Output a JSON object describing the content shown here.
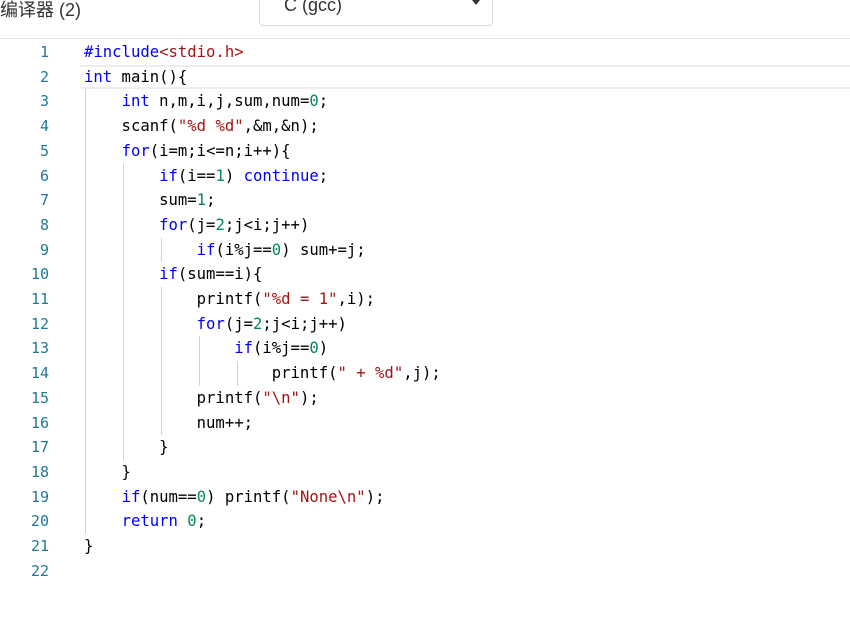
{
  "compiler_label": "编译器 (2)",
  "language_select": {
    "selected": "C (gcc)"
  },
  "editor": {
    "lines": [
      {
        "number": "1",
        "tokens": [
          {
            "t": "pp",
            "v": "#include"
          },
          {
            "t": "ppstr",
            "v": "<stdio.h>"
          }
        ]
      },
      {
        "number": "2",
        "tokens": [
          {
            "t": "kw",
            "v": "int"
          },
          {
            "t": "plain",
            "v": " main(){"
          }
        ]
      },
      {
        "number": "3",
        "tokens": [
          {
            "t": "plain",
            "v": "    "
          },
          {
            "t": "kw",
            "v": "int"
          },
          {
            "t": "plain",
            "v": " n,m,i,j,sum,num="
          },
          {
            "t": "num",
            "v": "0"
          },
          {
            "t": "plain",
            "v": ";"
          }
        ]
      },
      {
        "number": "4",
        "tokens": [
          {
            "t": "plain",
            "v": "    scanf("
          },
          {
            "t": "str",
            "v": "\"%d %d\""
          },
          {
            "t": "plain",
            "v": ",&m,&n);"
          }
        ]
      },
      {
        "number": "5",
        "tokens": [
          {
            "t": "plain",
            "v": "    "
          },
          {
            "t": "kw",
            "v": "for"
          },
          {
            "t": "plain",
            "v": "(i=m;i<=n;i++){"
          }
        ]
      },
      {
        "number": "6",
        "tokens": [
          {
            "t": "plain",
            "v": "        "
          },
          {
            "t": "kw",
            "v": "if"
          },
          {
            "t": "plain",
            "v": "(i=="
          },
          {
            "t": "num",
            "v": "1"
          },
          {
            "t": "plain",
            "v": ") "
          },
          {
            "t": "kw",
            "v": "continue"
          },
          {
            "t": "plain",
            "v": ";"
          }
        ]
      },
      {
        "number": "7",
        "tokens": [
          {
            "t": "plain",
            "v": "        sum="
          },
          {
            "t": "num",
            "v": "1"
          },
          {
            "t": "plain",
            "v": ";"
          }
        ]
      },
      {
        "number": "8",
        "tokens": [
          {
            "t": "plain",
            "v": "        "
          },
          {
            "t": "kw",
            "v": "for"
          },
          {
            "t": "plain",
            "v": "(j="
          },
          {
            "t": "num",
            "v": "2"
          },
          {
            "t": "plain",
            "v": ";j<i;j++)"
          }
        ]
      },
      {
        "number": "9",
        "tokens": [
          {
            "t": "plain",
            "v": "            "
          },
          {
            "t": "kw",
            "v": "if"
          },
          {
            "t": "plain",
            "v": "(i%j=="
          },
          {
            "t": "num",
            "v": "0"
          },
          {
            "t": "plain",
            "v": ") sum+=j;"
          }
        ]
      },
      {
        "number": "10",
        "tokens": [
          {
            "t": "plain",
            "v": "        "
          },
          {
            "t": "kw",
            "v": "if"
          },
          {
            "t": "plain",
            "v": "(sum==i){"
          }
        ]
      },
      {
        "number": "11",
        "tokens": [
          {
            "t": "plain",
            "v": "            printf("
          },
          {
            "t": "str",
            "v": "\"%d = 1\""
          },
          {
            "t": "plain",
            "v": ",i);"
          }
        ]
      },
      {
        "number": "12",
        "tokens": [
          {
            "t": "plain",
            "v": "            "
          },
          {
            "t": "kw",
            "v": "for"
          },
          {
            "t": "plain",
            "v": "(j="
          },
          {
            "t": "num",
            "v": "2"
          },
          {
            "t": "plain",
            "v": ";j<i;j++)"
          }
        ]
      },
      {
        "number": "13",
        "tokens": [
          {
            "t": "plain",
            "v": "                "
          },
          {
            "t": "kw",
            "v": "if"
          },
          {
            "t": "plain",
            "v": "(i%j=="
          },
          {
            "t": "num",
            "v": "0"
          },
          {
            "t": "plain",
            "v": ")"
          }
        ]
      },
      {
        "number": "14",
        "tokens": [
          {
            "t": "plain",
            "v": "                    printf("
          },
          {
            "t": "str",
            "v": "\" + %d\""
          },
          {
            "t": "plain",
            "v": ",j);"
          }
        ]
      },
      {
        "number": "15",
        "tokens": [
          {
            "t": "plain",
            "v": "            printf("
          },
          {
            "t": "str",
            "v": "\"\\n\""
          },
          {
            "t": "plain",
            "v": ");"
          }
        ]
      },
      {
        "number": "16",
        "tokens": [
          {
            "t": "plain",
            "v": "            num++;"
          }
        ]
      },
      {
        "number": "17",
        "tokens": [
          {
            "t": "plain",
            "v": "        }"
          }
        ]
      },
      {
        "number": "18",
        "tokens": [
          {
            "t": "plain",
            "v": "    }"
          }
        ]
      },
      {
        "number": "19",
        "tokens": [
          {
            "t": "plain",
            "v": "    "
          },
          {
            "t": "kw",
            "v": "if"
          },
          {
            "t": "plain",
            "v": "(num=="
          },
          {
            "t": "num",
            "v": "0"
          },
          {
            "t": "plain",
            "v": ") printf("
          },
          {
            "t": "str",
            "v": "\"None\\n\""
          },
          {
            "t": "plain",
            "v": ");"
          }
        ]
      },
      {
        "number": "20",
        "tokens": [
          {
            "t": "plain",
            "v": "    "
          },
          {
            "t": "kw",
            "v": "return"
          },
          {
            "t": "plain",
            "v": " "
          },
          {
            "t": "num",
            "v": "0"
          },
          {
            "t": "plain",
            "v": ";"
          }
        ]
      },
      {
        "number": "21",
        "tokens": [
          {
            "t": "plain",
            "v": "}"
          }
        ]
      },
      {
        "number": "22",
        "tokens": []
      }
    ],
    "current_line": "2"
  },
  "colors": {
    "keyword": "#0000ff",
    "string": "#a31515",
    "number": "#098658",
    "line_number": "#237893",
    "indent_guide": "#d3d3d3"
  }
}
